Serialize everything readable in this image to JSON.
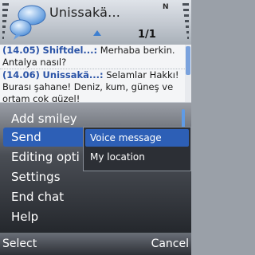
{
  "header": {
    "title": "Unissakä...",
    "operator_label": "N",
    "page_indicator": "1/1"
  },
  "chat": {
    "messages": [
      {
        "time": "(14.05)",
        "sender": "Shiftdel...:",
        "text": "Merhaba berkin. Antalya nasıl?"
      },
      {
        "time": "(14.06)",
        "sender": "Unissakä...:",
        "text": "Selamlar Hakkı! Burası şahane! Deniz, kum, güneş ve ortam çok güzel!"
      }
    ]
  },
  "menu": {
    "items": [
      "Add smiley",
      "Send",
      "Editing opti",
      "Settings",
      "End chat",
      "Help"
    ],
    "selected": "Send"
  },
  "submenu": {
    "items": [
      "Voice message",
      "My location"
    ],
    "selected": "Voice message"
  },
  "softkeys": {
    "left": "Select",
    "right": "Cancel"
  },
  "colors": {
    "highlight": "#2d5fb6",
    "sender_blue": "#2a53a6"
  }
}
